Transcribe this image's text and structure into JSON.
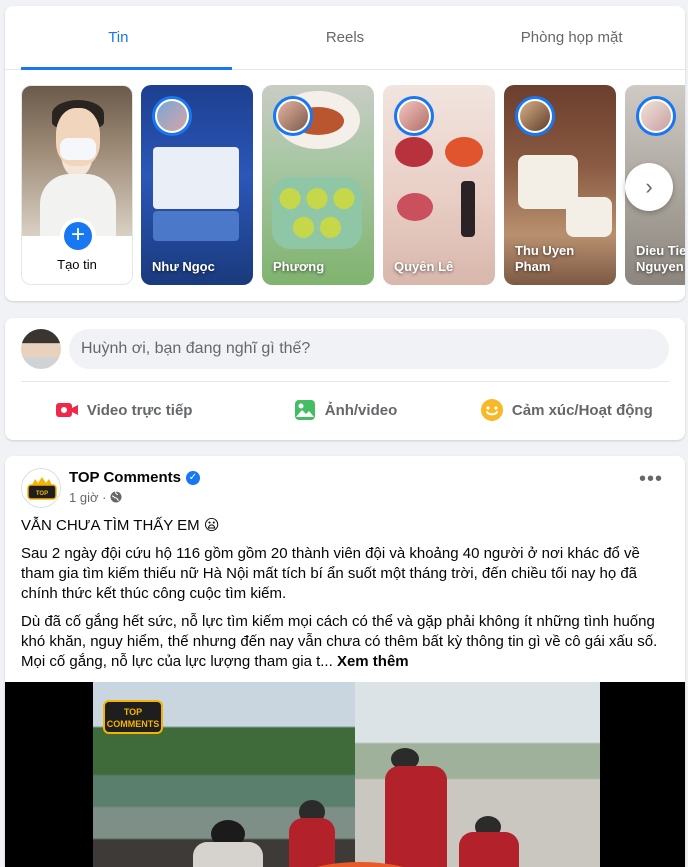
{
  "tabs": [
    {
      "label": "Tin",
      "active": true
    },
    {
      "label": "Reels",
      "active": false
    },
    {
      "label": "Phòng họp mặt",
      "active": false
    }
  ],
  "stories": {
    "create_label": "Tạo tin",
    "items": [
      {
        "name": "Như Ngọc"
      },
      {
        "name": "Phương"
      },
      {
        "name": "Quyên Lê"
      },
      {
        "name": "Thu Uyen Pham"
      },
      {
        "name": "Dieu Tien Nguyen"
      }
    ]
  },
  "composer": {
    "placeholder": "Huỳnh ơi, bạn đang nghĩ gì thế?",
    "actions": [
      {
        "label": "Video trực tiếp",
        "icon": "live-video-icon",
        "color": "#f02849"
      },
      {
        "label": "Ảnh/video",
        "icon": "photo-icon",
        "color": "#45bd62"
      },
      {
        "label": "Cảm xúc/Hoạt động",
        "icon": "feeling-icon",
        "color": "#f7b928"
      }
    ]
  },
  "post": {
    "author": "TOP Comments",
    "time": "1 giờ",
    "headline": "VẪN CHƯA TÌM THẤY EM 😦",
    "paragraph1": "Sau 2 ngày đội cứu hộ 116 gồm gồm 20 thành viên đội và khoảng 40 người ở nơi khác đổ về tham gia tìm kiếm thiếu nữ Hà Nội mất tích bí ẩn suốt một tháng trời, đến chiều tối nay họ đã chính thức kết thúc công cuộc tìm kiếm.",
    "paragraph2": "Dù đã cố gắng hết sức, nỗ lực tìm kiếm mọi cách có thể và gặp phải không ít những tình huống khó khăn, nguy hiểm, thế nhưng đến nay vẫn chưa có thêm bất kỳ thông tin gì về cô gái xấu số. Mọi cố gắng, nỗ lực của lực lượng tham gia t...",
    "see_more": "Xem thêm",
    "logo_text": "TOP COMMENTS"
  },
  "colors": {
    "accent": "#1877f2",
    "background": "#f0f2f5",
    "secondary_text": "#65676b"
  }
}
